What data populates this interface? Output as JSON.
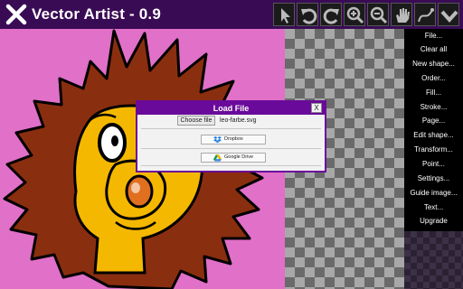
{
  "app": {
    "title": "Vector Artist - 0.9"
  },
  "toolbar": {
    "tools": [
      {
        "name": "pointer",
        "icon": "arrow-pointer-icon"
      },
      {
        "name": "undo",
        "icon": "undo-icon"
      },
      {
        "name": "redo",
        "icon": "redo-icon"
      },
      {
        "name": "zoom-in",
        "icon": "zoom-in-icon"
      },
      {
        "name": "zoom-out",
        "icon": "zoom-out-icon"
      },
      {
        "name": "pan",
        "icon": "hand-icon"
      },
      {
        "name": "freehand",
        "icon": "curve-icon"
      },
      {
        "name": "more",
        "icon": "chevron-down-icon"
      }
    ]
  },
  "menu": {
    "items": [
      "File...",
      "Clear all",
      "New shape...",
      "Order...",
      "Fill...",
      "Stroke...",
      "Page...",
      "Edit shape...",
      "Transform...",
      "Point...",
      "Settings...",
      "Guide image...",
      "Text...",
      "Upgrade"
    ]
  },
  "dialog": {
    "title": "Load File",
    "close": "X",
    "choose_file": "Choose file",
    "file_name": "leo-farbe.svg",
    "dropbox": "Dropbox",
    "google_drive": "Google Drive"
  },
  "colors": {
    "titlebar": "#3a0b55",
    "dialog_accent": "#6a0a9a",
    "canvas_bg": "#e070c8",
    "mane": "#8a2e10",
    "face": "#f5b800"
  }
}
